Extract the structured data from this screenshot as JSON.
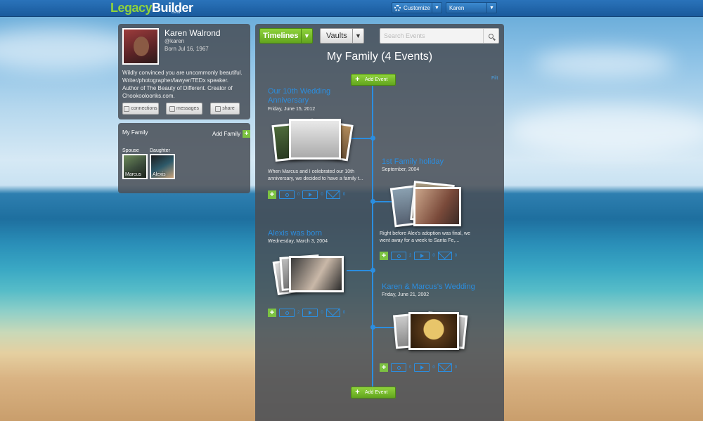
{
  "app": {
    "logo_part1": "Legacy",
    "logo_part2": "Builder",
    "beta": "Beta"
  },
  "topbar": {
    "customize": "Customize",
    "user": "Karen"
  },
  "profile": {
    "name": "Karen Walrond",
    "handle": "@karen",
    "born": "Born  Jul 16, 1967",
    "bio": "Wildly convinced you are uncommonly beautiful. Writer/photographer/lawyer/TEDx speaker. Author of The Beauty of Different. Creator of Chookooloonks.com.",
    "buttons": {
      "connections": "connections",
      "messages": "messages",
      "share": "share"
    }
  },
  "family": {
    "title": "My Family",
    "add_label": "Add Family",
    "members": [
      {
        "relation": "Spouse",
        "name": "Marcus"
      },
      {
        "relation": "Daughter",
        "name": "Alexis"
      }
    ]
  },
  "timeline_panel": {
    "timelines_btn": "Timelines",
    "vaults_btn": "Vaults",
    "search_placeholder": "Search Events",
    "title": "My Family (4 Events)",
    "filter_link": "Filt",
    "add_event_label": "Add Event"
  },
  "events": [
    {
      "title": "Our 10th Wedding Anniversary",
      "date": "Friday, June 15, 2012",
      "desc": "When Marcus and I celebrated our 10th anniversary, we decided to have a family t...",
      "photos": "0",
      "videos": "0",
      "messages": "0"
    },
    {
      "title": "1st Family holiday",
      "date": "September, 2004",
      "desc": "Right before Alex's adoption was final, we went away for a week to Santa Fe,...",
      "photos": "2",
      "videos": "0",
      "messages": "0"
    },
    {
      "title": "Alexis was born",
      "date": "Wednesday, March 3, 2004",
      "desc": "",
      "photos": "2",
      "videos": "0",
      "messages": "0"
    },
    {
      "title": "Karen & Marcus's Wedding",
      "date": "Friday, June 21, 2002",
      "desc": "",
      "photos": "0",
      "videos": "0",
      "messages": "0"
    }
  ],
  "colors": {
    "accent_blue": "#2b8ee0",
    "accent_green": "#7cc242",
    "topbar": "#1f64a8"
  }
}
